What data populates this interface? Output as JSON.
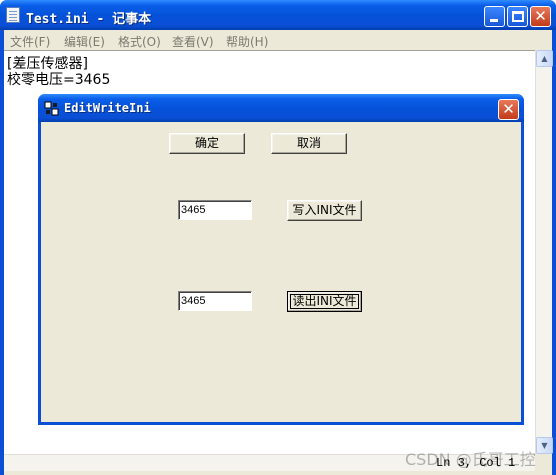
{
  "notepad": {
    "title": "Test.ini - 记事本",
    "menu": [
      {
        "label": "文件(F)"
      },
      {
        "label": "编辑(E)"
      },
      {
        "label": "格式(O)"
      },
      {
        "label": "查看(V)"
      },
      {
        "label": "帮助(H)"
      }
    ],
    "content_lines": [
      "[差压传感器]",
      "校零电压=3465"
    ],
    "status_position": "Ln 3, Col 1"
  },
  "dialog": {
    "title": "EditWriteIni",
    "ok_label": "确定",
    "cancel_label": "取消",
    "write_value": "3465",
    "write_button_label": "写入INI文件",
    "read_value": "3465",
    "read_button_label": "读出INI文件"
  },
  "watermark": "CSDN @氏哥工控",
  "colors": {
    "titlebar": "#0a4fd6",
    "face": "#ece9d8",
    "close_button": "#c13c19"
  }
}
